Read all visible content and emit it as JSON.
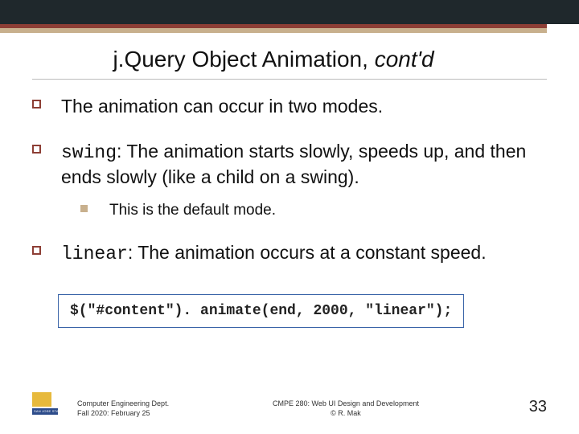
{
  "title": {
    "main": "j.Query Object Animation, ",
    "contd": "cont'd"
  },
  "bullets": [
    {
      "text": "The animation can occur in two modes."
    },
    {
      "keyword": "swing",
      "rest": ": The animation starts slowly, speeds up, and then ends slowly (like a child on a swing).",
      "sub": [
        {
          "text": "This is the default mode."
        }
      ]
    },
    {
      "keyword": "linear",
      "rest": ": The animation occurs at a constant speed."
    }
  ],
  "code": "$(\"#content\"). animate(end, 2000, \"linear\");",
  "footer": {
    "logo_text": "SAN JOSE STATE",
    "left_line1": "Computer Engineering Dept.",
    "left_line2": "Fall 2020: February 25",
    "mid_line1": "CMPE 280: Web UI Design and Development",
    "mid_line2": "© R. Mak",
    "page": "33"
  }
}
